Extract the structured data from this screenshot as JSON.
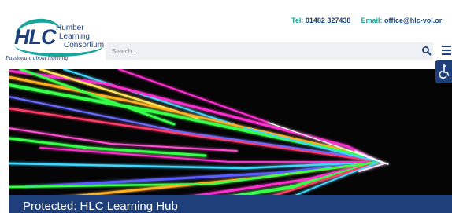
{
  "logo": {
    "abbr": "HLC",
    "line1": "Humber",
    "line2": "Learning",
    "line3": "Consortium",
    "tagline": "Passionate about learning"
  },
  "contact": {
    "tel_label": "Tel:",
    "tel_number": "01482 327438",
    "email_label": "Email:",
    "email_address": "office@hlc-vol.or"
  },
  "search": {
    "placeholder": "Search..."
  },
  "icons": {
    "search": "search-icon",
    "menu": "hamburger-menu-icon",
    "accessibility": "wheelchair-icon"
  },
  "page": {
    "title": "Protected: HLC Learning Hub"
  },
  "colors": {
    "brand_navy": "#1e3f7a",
    "brand_teal": "#1aa59a",
    "search_bg": "#eef0f3"
  }
}
